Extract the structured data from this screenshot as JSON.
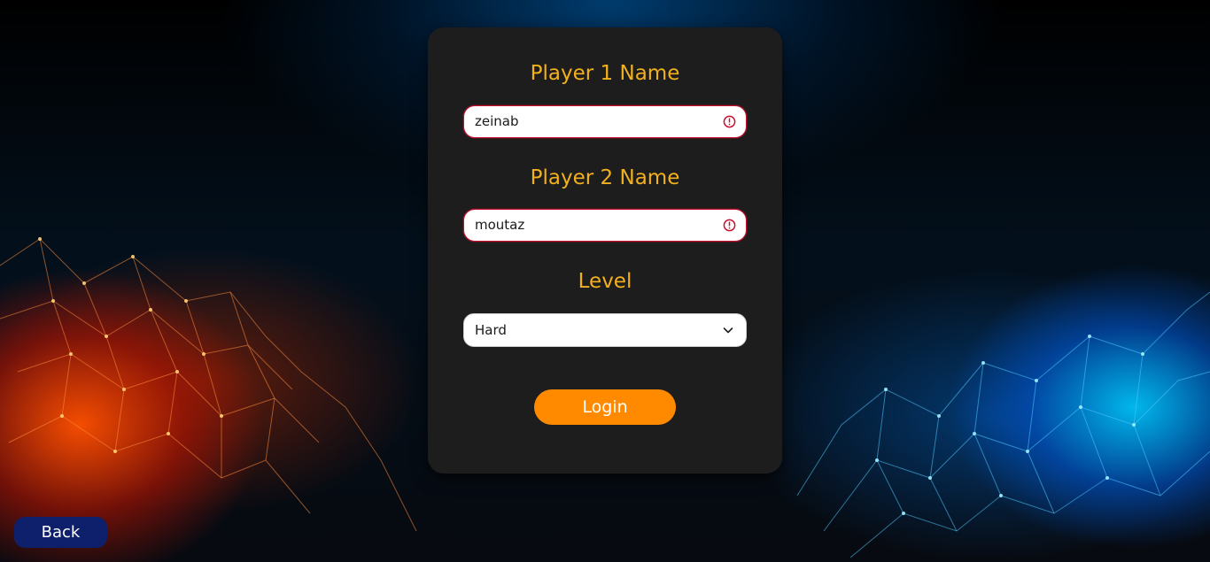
{
  "form": {
    "player1": {
      "label": "Player 1 Name",
      "value": "zeinab",
      "error_icon": "exclamation-circle-icon"
    },
    "player2": {
      "label": "Player 2 Name",
      "value": "moutaz",
      "error_icon": "exclamation-circle-icon"
    },
    "level": {
      "label": "Level",
      "selected": "Hard",
      "dropdown_icon": "chevron-down-icon"
    },
    "login_label": "Login"
  },
  "back_label": "Back",
  "colors": {
    "label_text": "#f2b01c",
    "login_button": "#ff8a00",
    "back_button": "#0e1f6b",
    "card": "#1d1d1d",
    "error_border": "#c8102e"
  }
}
